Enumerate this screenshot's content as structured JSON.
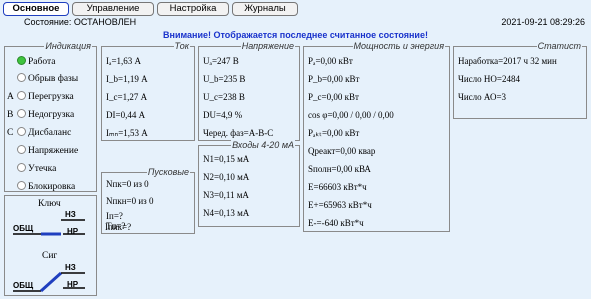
{
  "tabs": [
    {
      "label": "Основное",
      "active": true
    },
    {
      "label": "Управление",
      "active": false
    },
    {
      "label": "Настройка",
      "active": false
    },
    {
      "label": "Журналы",
      "active": false
    }
  ],
  "status": {
    "text": "Состояние: ОСТАНОВЛЕН",
    "datetime": "2021-09-21 08:29:26"
  },
  "warning": "Внимание! Отображается последнее считанное состояние!",
  "indication": {
    "title": "Индикация",
    "items": [
      {
        "prefix": "",
        "label": "Работа",
        "on": true
      },
      {
        "prefix": "",
        "label": "Обрыв фазы",
        "on": false
      },
      {
        "prefix": "A",
        "label": "Перегрузка",
        "on": false
      },
      {
        "prefix": "B",
        "label": "Недогрузка",
        "on": false
      },
      {
        "prefix": "C",
        "label": "Дисбаланс",
        "on": false
      },
      {
        "prefix": "",
        "label": "Напряжение",
        "on": false
      },
      {
        "prefix": "",
        "label": "Утечка",
        "on": false
      },
      {
        "prefix": "",
        "label": "Блокировка",
        "on": false
      }
    ]
  },
  "current": {
    "title": "Ток",
    "rows": [
      "Iₐ=1,63 А",
      "I_b=1,19 А",
      "I_c=1,27 А",
      "DI=0,44 А",
      "Iₘₙ=1,53 А"
    ]
  },
  "voltage": {
    "title": "Напряжение",
    "rows": [
      "Uₐ=247 В",
      "U_b=235 В",
      "U_c=238 В",
      "DU=4,9 %",
      "Черед. фаз=A-B-C"
    ]
  },
  "power": {
    "title": "Мощность и энергия",
    "rows": [
      "Pₐ=0,00 кВт",
      "P_b=0,00 кВт",
      "P_c=0,00 кВт",
      "cos φ=0,00 / 0,00 / 0,00",
      "Pₐₖₜ=0,00 кВт",
      "Qреакт=0,00 квар",
      "Sполн=0,00 кВА",
      "E=66603 кВт*ч",
      "E+=65963 кВт*ч",
      "E-=-640 кВт*ч"
    ]
  },
  "stats": {
    "title": "Статист",
    "rows": [
      "Наработка=2017 ч 32 мин",
      "Число НО=2484",
      "Число АО=3"
    ]
  },
  "starting": {
    "title": "Пусковые",
    "rows": [
      "Nпк=0 из 0",
      "Nпкн=0 из 0",
      "Iп=?",
      "Tп=?",
      "Iпик=?"
    ]
  },
  "inputs": {
    "title": "Входы 4-20 мА",
    "rows": [
      "N1=0,15 мА",
      "N2=0,10 мА",
      "N3=0,11 мА",
      "N4=0,13 мА"
    ]
  },
  "key": {
    "title": "Ключ",
    "nz": "НЗ",
    "obsh": "ОБЩ",
    "nr": "НР"
  },
  "sig": {
    "title": "Сиг",
    "nz": "НЗ",
    "obsh": "ОБЩ",
    "nr": "НР"
  }
}
